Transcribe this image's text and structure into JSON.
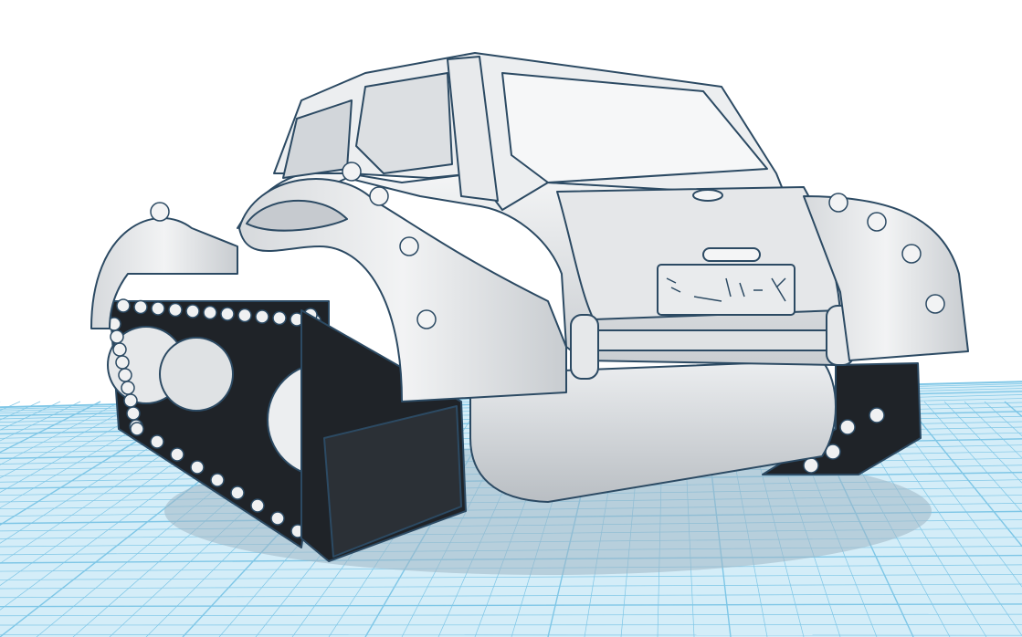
{
  "viewport": {
    "background_color": "#ffffff",
    "grid_color": "#7ec6e6",
    "grid_major_color": "#5fb0d6",
    "grid_fill": "#cfeaf6"
  },
  "model": {
    "body_color": "#e3e5e7",
    "body_shade": "#bfc3c7",
    "outline_color": "#2c4a63",
    "track_color": "#1f2328",
    "track_shade": "#3a4047",
    "bolt_color": "#f0f1f2"
  }
}
